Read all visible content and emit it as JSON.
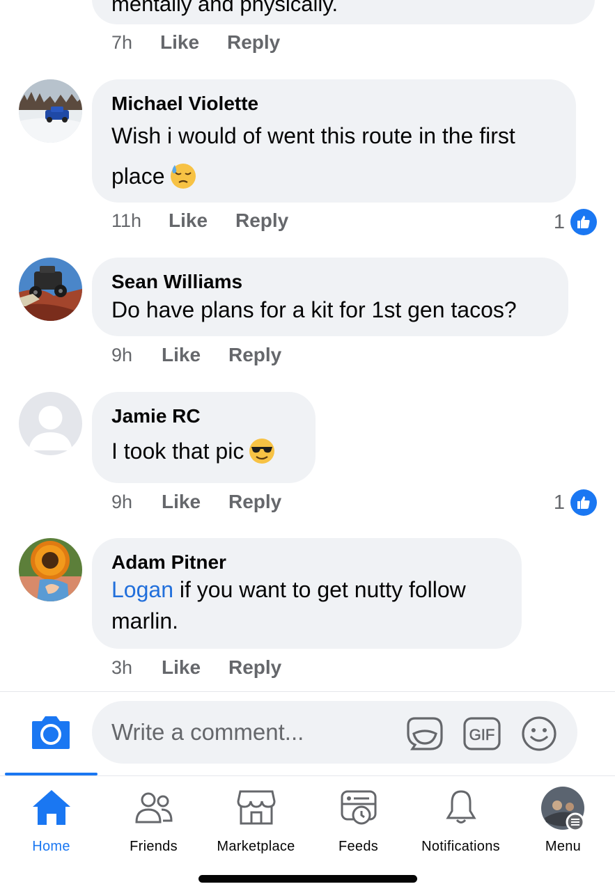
{
  "previous_comment": {
    "cut_text": "mentally and physically.",
    "time": "7h",
    "like_label": "Like",
    "reply_label": "Reply"
  },
  "comments": [
    {
      "name": "Michael Violette",
      "text_line1": "Wish i would of went this route in the first",
      "text_line2": "place",
      "emoji": "downcast-face-with-sweat",
      "time": "11h",
      "like_label": "Like",
      "reply_label": "Reply",
      "reaction_count": "1"
    },
    {
      "name": "Sean Williams",
      "text": "Do have plans for a kit for 1st gen tacos?",
      "time": "9h",
      "like_label": "Like",
      "reply_label": "Reply"
    },
    {
      "name": "Jamie RC",
      "text": "I took that pic",
      "emoji": "smiling-face-with-sunglasses",
      "time": "9h",
      "like_label": "Like",
      "reply_label": "Reply",
      "reaction_count": "1"
    },
    {
      "name": "Adam Pitner",
      "mention": "Logan",
      "text_after_mention": " if you want to get nutty follow",
      "text_line2": "marlin.",
      "time": "3h",
      "like_label": "Like",
      "reply_label": "Reply"
    }
  ],
  "composer": {
    "placeholder": "Write a comment...",
    "icons": [
      "camera-icon",
      "avatar-sticker-icon",
      "gif-icon",
      "emoji-icon"
    ]
  },
  "tabs": [
    {
      "label": "Home",
      "icon": "home-icon",
      "active": true
    },
    {
      "label": "Friends",
      "icon": "friends-icon",
      "active": false
    },
    {
      "label": "Marketplace",
      "icon": "marketplace-icon",
      "active": false
    },
    {
      "label": "Feeds",
      "icon": "feeds-icon",
      "active": false
    },
    {
      "label": "Notifications",
      "icon": "bell-icon",
      "active": false
    },
    {
      "label": "Menu",
      "icon": "profile-menu-icon",
      "active": false
    }
  ],
  "colors": {
    "accent": "#1a77f2",
    "mention": "#216fdb",
    "bubble": "#f0f2f5",
    "meta_text": "#65676b"
  }
}
